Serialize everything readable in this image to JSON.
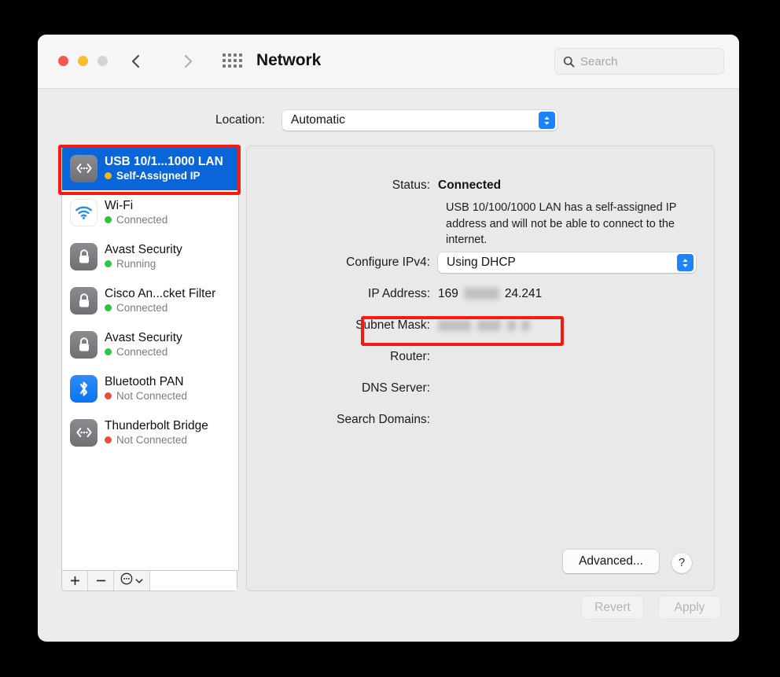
{
  "window": {
    "title": "Network",
    "traffic_lights": [
      "close",
      "minimize",
      "zoom"
    ]
  },
  "toolbar": {
    "back_icon": "chevron-left-icon",
    "forward_icon": "chevron-right-icon",
    "grid_icon": "grid-apps-icon",
    "search": {
      "placeholder": "Search",
      "value": "",
      "icon": "search-icon"
    }
  },
  "location": {
    "label": "Location:",
    "selected": "Automatic",
    "options": [
      "Automatic"
    ]
  },
  "sidebar": {
    "items": [
      {
        "name": "USB 10/1...1000 LAN",
        "status": "Self-Assigned IP",
        "status_color": "#f6b519",
        "icon": "ethernet-icon",
        "icon_style": "grey",
        "selected": true
      },
      {
        "name": "Wi-Fi",
        "status": "Connected",
        "status_color": "#27c93f",
        "icon": "wifi-icon",
        "icon_style": "white",
        "selected": false
      },
      {
        "name": "Avast Security",
        "status": "Running",
        "status_color": "#27c93f",
        "icon": "lock-icon",
        "icon_style": "grey",
        "selected": false
      },
      {
        "name": "Cisco An...cket Filter",
        "status": "Connected",
        "status_color": "#27c93f",
        "icon": "lock-icon",
        "icon_style": "grey",
        "selected": false
      },
      {
        "name": "Avast Security",
        "status": "Connected",
        "status_color": "#27c93f",
        "icon": "lock-icon",
        "icon_style": "grey",
        "selected": false
      },
      {
        "name": "Bluetooth PAN",
        "status": "Not Connected",
        "status_color": "#ee4b3c",
        "icon": "bluetooth-icon",
        "icon_style": "blue",
        "selected": false
      },
      {
        "name": "Thunderbolt Bridge",
        "status": "Not Connected",
        "status_color": "#ee4b3c",
        "icon": "ethernet-icon",
        "icon_style": "grey",
        "selected": false
      }
    ],
    "toolbar": {
      "add_icon": "plus-icon",
      "remove_icon": "minus-icon",
      "actions_icon": "ellipsis-circle-icon",
      "actions_chevron_icon": "chevron-down-icon"
    }
  },
  "detail": {
    "status_label": "Status:",
    "status_value": "Connected",
    "status_description": "USB 10/100/1000 LAN has a self-assigned IP address and will not be able to connect to the internet.",
    "ipv4_label": "Configure IPv4:",
    "ipv4_value": "Using DHCP",
    "ipv4_options": [
      "Using DHCP"
    ],
    "ip_label": "IP Address:",
    "ip_value_prefix": "169",
    "ip_value_suffix": "24.241",
    "ip_value_redacted": true,
    "subnet_label": "Subnet Mask:",
    "subnet_value": "",
    "subnet_redacted": true,
    "router_label": "Router:",
    "router_value": "",
    "dns_label": "DNS Server:",
    "dns_value": "",
    "search_domains_label": "Search Domains:",
    "search_domains_value": "",
    "advanced_label": "Advanced...",
    "help_label": "?"
  },
  "footer": {
    "revert_label": "Revert",
    "apply_label": "Apply",
    "revert_enabled": false,
    "apply_enabled": false
  },
  "annotations": {
    "highlight_color": "#f61a12",
    "regions": [
      "selected-network-item",
      "ip-address-row"
    ]
  }
}
